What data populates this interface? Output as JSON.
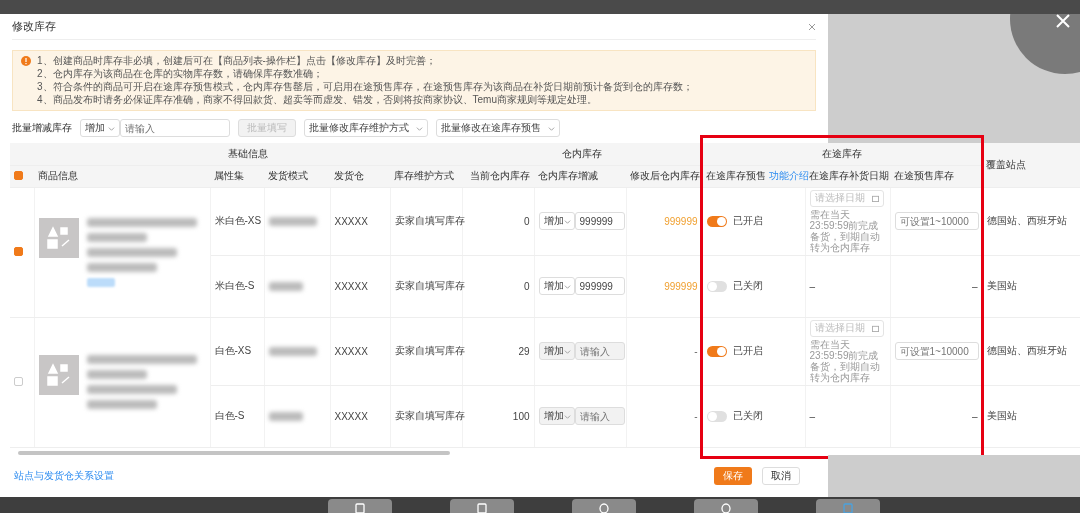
{
  "dialog": {
    "title": "修改库存"
  },
  "notice": [
    "1、创建商品时库存非必填，创建后可在【商品列表-操作栏】点击【修改库存】及时完善；",
    "2、仓内库存为该商品在仓库的实物库存数，请确保库存数准确；",
    "3、符合条件的商品可开启在途库存预售模式，仓内库存售罄后，可启用在途预售库存，在途预售库存为该商品在补货日期前预计备货到仓的库存数；",
    "4、商品发布时请务必保证库存准确，商家不得回款货、超卖等而虚发、错发，否则将按商家协议、Temu商家规则等规定处理。"
  ],
  "toolbar": {
    "label": "批量增减库存",
    "mode": "增加",
    "input_placeholder": "请输入",
    "fill_button": "批量填写",
    "fill_disabled": true,
    "maintain_select": "批量修改库存维护方式",
    "presale_select": "批量修改在途库存预售"
  },
  "groups": [
    {
      "label": "基础信息"
    },
    {
      "label": "仓内库存"
    },
    {
      "label": "在途库存"
    }
  ],
  "columns": [
    "商品信息",
    "属性集",
    "发货模式",
    "发货仓",
    "库存维护方式",
    "当前仓内库存",
    "仓内库存增减",
    "修改后仓内库存",
    "在途库存预售",
    "在途库存补货日期",
    "在途预售库存"
  ],
  "presale_link": "功能介绍",
  "sites_column": "覆盖站点",
  "header_checked": true,
  "products": [
    {
      "checked": true,
      "variants": [
        {
          "attr": "米白色-XS",
          "warehouse": "XXXXX",
          "method": "卖家自填写库存",
          "current": "0",
          "change_mode": "增加",
          "change_value": "999999",
          "change_disabled": false,
          "after": "999999",
          "presale_on": true,
          "presale_label": "已开启",
          "date_placeholder": "请选择日期",
          "date_note": "需在当天23:59:59前完成备货，到期自动转为仓内库存",
          "stock_placeholder": "可设置1~10000",
          "sites": "德国站、西班牙站"
        },
        {
          "attr": "米白色-S",
          "warehouse": "XXXXX",
          "method": "卖家自填写库存",
          "current": "0",
          "change_mode": "增加",
          "change_value": "999999",
          "change_disabled": false,
          "after": "999999",
          "presale_on": false,
          "presale_label": "已关闭",
          "date_dash": "–",
          "stock_dash": "–",
          "sites": "美国站"
        }
      ]
    },
    {
      "checked": false,
      "variants": [
        {
          "attr": "白色-XS",
          "warehouse": "XXXXX",
          "method": "卖家自填写库存",
          "current": "29",
          "change_mode": "增加",
          "change_placeholder": "请输入",
          "change_disabled": true,
          "after": "-",
          "presale_on": true,
          "presale_label": "已开启",
          "date_placeholder": "请选择日期",
          "date_note": "需在当天23:59:59前完成备货，到期自动转为仓内库存",
          "stock_placeholder": "可设置1~10000",
          "sites": "德国站、西班牙站"
        },
        {
          "attr": "白色-S",
          "warehouse": "XXXXX",
          "method": "卖家自填写库存",
          "current": "100",
          "change_mode": "增加",
          "change_placeholder": "请输入",
          "change_disabled": true,
          "after": "-",
          "presale_on": false,
          "presale_label": "已关闭",
          "date_dash": "–",
          "stock_dash": "–",
          "sites": "美国站"
        }
      ]
    }
  ],
  "footer": {
    "link": "站点与发货仓关系设置",
    "save": "保存",
    "cancel": "取消"
  }
}
